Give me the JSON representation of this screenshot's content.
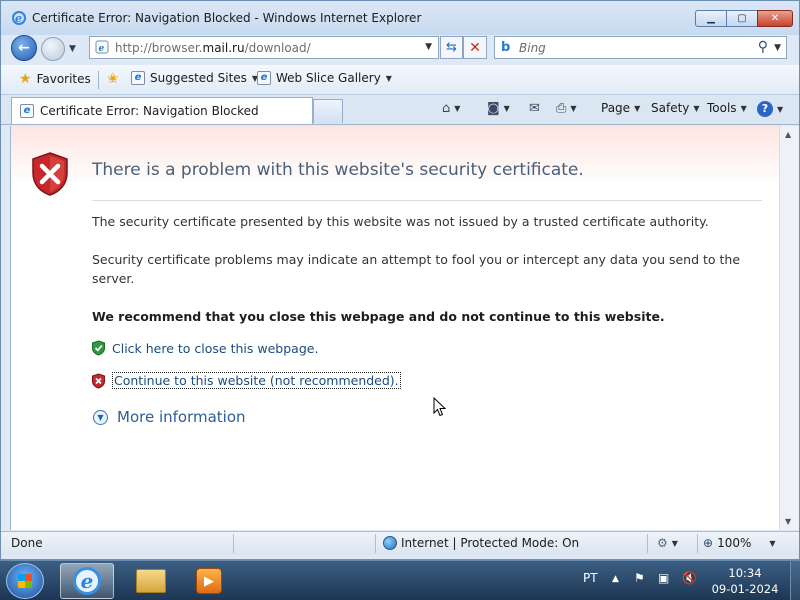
{
  "window": {
    "title": "Certificate Error: Navigation Blocked - Windows Internet Explorer"
  },
  "navigation": {
    "url_prefix": "http://browser.",
    "url_domain": "mail.ru",
    "url_path": "/download/",
    "search_placeholder": "Bing"
  },
  "favorites_bar": {
    "favorites_label": "Favorites",
    "items": [
      {
        "label": "Suggested Sites"
      },
      {
        "label": "Web Slice Gallery"
      }
    ]
  },
  "tab": {
    "title": "Certificate Error: Navigation Blocked"
  },
  "command_bar": {
    "page_label": "Page",
    "safety_label": "Safety",
    "tools_label": "Tools"
  },
  "content": {
    "headline": "There is a problem with this website's security certificate.",
    "paragraph_1": "The security certificate presented by this website was not issued by a trusted certificate authority.",
    "paragraph_2": "Security certificate problems may indicate an attempt to fool you or intercept any data you send to the server.",
    "recommendation": "We recommend that you close this webpage and do not continue to this website.",
    "close_link": "Click here to close this webpage.",
    "continue_link": "Continue to this website (not recommended).",
    "more_info": "More information"
  },
  "status_bar": {
    "status": "Done",
    "zone": "Internet | Protected Mode: On",
    "zoom": "100%"
  },
  "taskbar": {
    "language": "PT",
    "time": "10:34",
    "date": "09-01-2024"
  },
  "colors": {
    "headline": "#4a5f78",
    "link": "#1a4b80",
    "shield_red": "#c8282b",
    "shield_green": "#2e9a3e"
  }
}
